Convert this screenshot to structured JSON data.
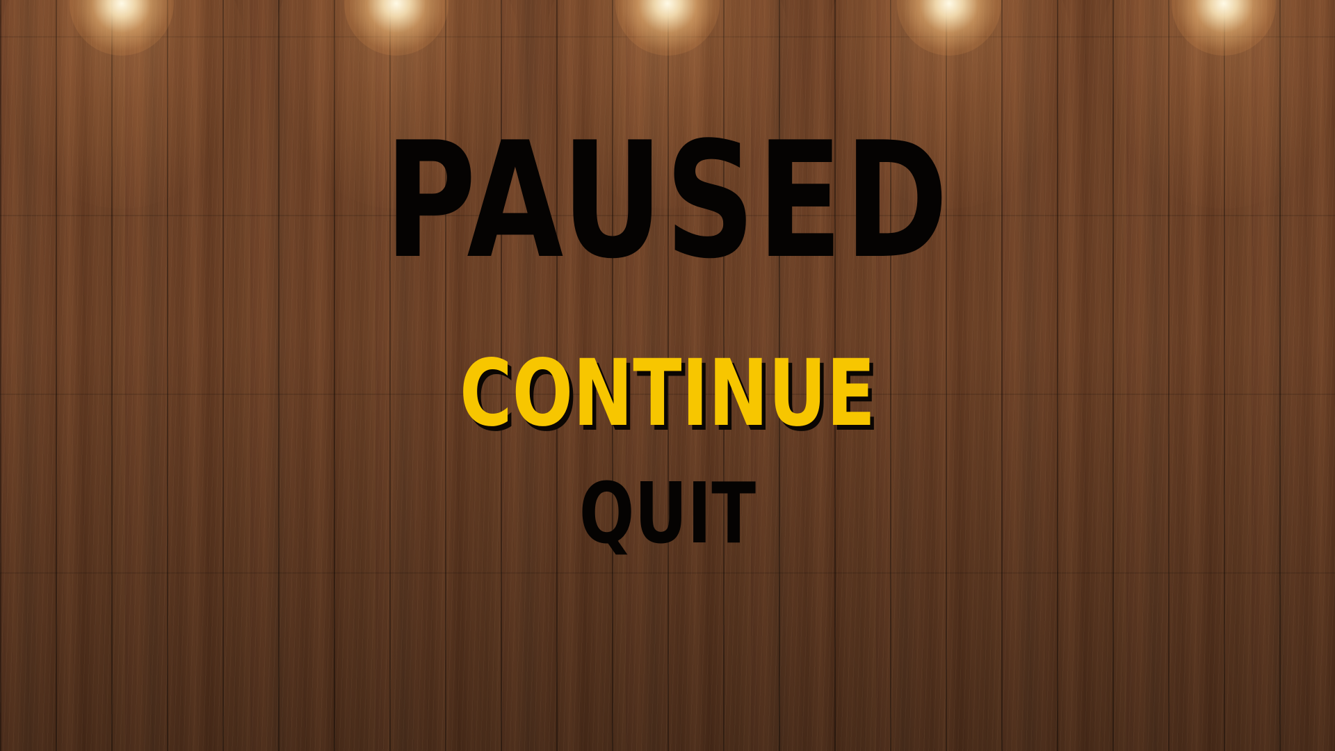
{
  "menu": {
    "title": "PAUSED",
    "items": [
      {
        "label": "CONTINUE",
        "selected": true
      },
      {
        "label": "QUIT",
        "selected": false
      }
    ]
  },
  "colors": {
    "selected_item": "#f7c600",
    "unselected_item": "#050302",
    "title": "#050302"
  }
}
